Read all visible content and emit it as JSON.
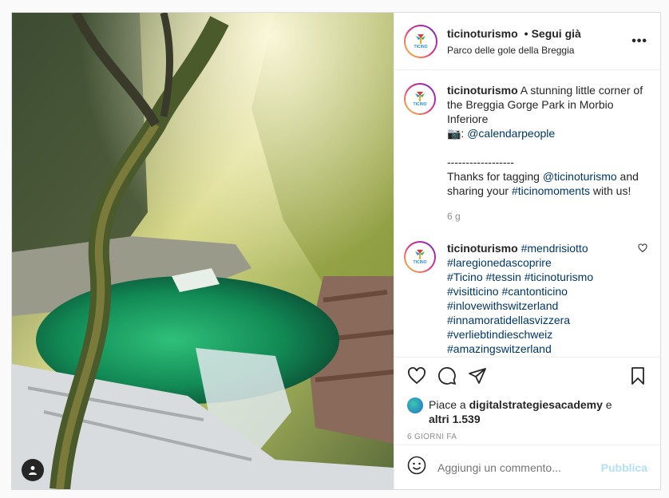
{
  "header": {
    "username": "ticinoturismo",
    "separator": "•",
    "follow_label": "Segui già",
    "location": "Parco delle gole della Breggia",
    "more_label": "•••"
  },
  "avatar_label": "TICINO",
  "caption": {
    "username": "ticinoturismo",
    "text": "A stunning little corner of the Breggia Gorge Park in Morbio Inferiore",
    "camera": "📷:",
    "credit": "@calendarpeople",
    "divider": "------------------",
    "thanks_1": "Thanks for tagging ",
    "thanks_mention": "@ticinoturismo",
    "thanks_2": " and sharing your ",
    "thanks_tag": "#ticinomoments",
    "thanks_3": " with us!",
    "time": "6 g"
  },
  "hashtag_comment": {
    "username": "ticinoturismo",
    "tags": [
      "#mendrisiotto",
      "#laregionedascoprire",
      "#Ticino #tessin #ticinoturismo",
      "#visitticino #cantonticino",
      "#inlovewithswitzerland",
      "#innamoratidellasvizzera",
      "#verliebtindieschweiz",
      "#amazingswitzerland"
    ]
  },
  "likes": {
    "prefix": "Piace a ",
    "user": "digitalstrategiesacademy",
    "middle": " e",
    "others": "altri 1.539"
  },
  "time_ago": "6 GIORNI FA",
  "comment_box": {
    "placeholder": "Aggiungi un commento...",
    "publish_label": "Pubblica"
  },
  "icons": [
    "heart-icon",
    "comment-icon",
    "share-icon",
    "bookmark-icon",
    "emoji-icon",
    "user-tag-icon",
    "more-icon"
  ],
  "colors": {
    "link": "#00376b",
    "publish_disabled": "#b2dffc",
    "meta": "#8e8e8e"
  }
}
